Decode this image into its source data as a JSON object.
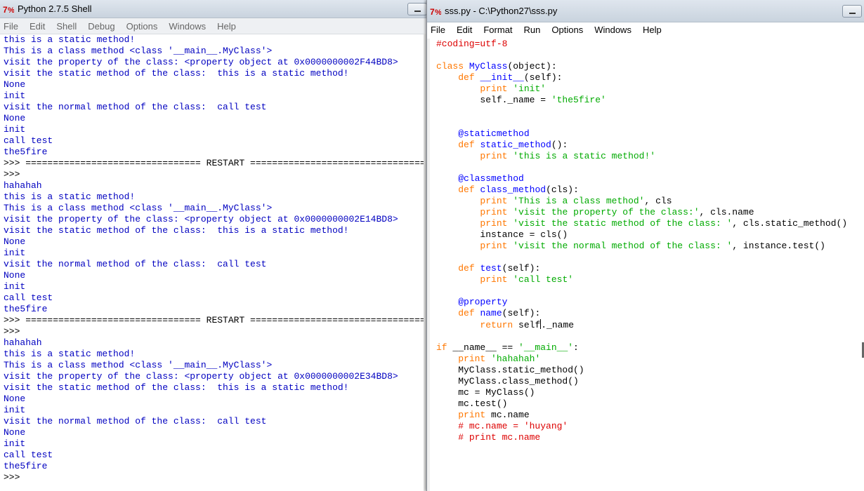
{
  "shell": {
    "title": "Python 2.7.5 Shell",
    "menu": [
      "File",
      "Edit",
      "Shell",
      "Debug",
      "Options",
      "Windows",
      "Help"
    ],
    "lines": [
      {
        "t": "this is a static method!",
        "c": "out"
      },
      {
        "t": "This is a class method <class '__main__.MyClass'>",
        "c": "out"
      },
      {
        "t": "visit the property of the class: <property object at 0x0000000002F44BD8>",
        "c": "out"
      },
      {
        "t": "visit the static method of the class:  this is a static method!",
        "c": "out"
      },
      {
        "t": "None",
        "c": "out"
      },
      {
        "t": "init",
        "c": "out"
      },
      {
        "t": "visit the normal method of the class:  call test",
        "c": "out"
      },
      {
        "t": "None",
        "c": "out"
      },
      {
        "t": "init",
        "c": "out"
      },
      {
        "t": "call test",
        "c": "out"
      },
      {
        "t": "the5fire",
        "c": "out"
      },
      {
        "t": ">>> ================================ RESTART ================================",
        "c": "sys"
      },
      {
        "t": ">>>",
        "c": "sys"
      },
      {
        "t": "hahahah",
        "c": "out"
      },
      {
        "t": "this is a static method!",
        "c": "out"
      },
      {
        "t": "This is a class method <class '__main__.MyClass'>",
        "c": "out"
      },
      {
        "t": "visit the property of the class: <property object at 0x0000000002E14BD8>",
        "c": "out"
      },
      {
        "t": "visit the static method of the class:  this is a static method!",
        "c": "out"
      },
      {
        "t": "None",
        "c": "out"
      },
      {
        "t": "init",
        "c": "out"
      },
      {
        "t": "visit the normal method of the class:  call test",
        "c": "out"
      },
      {
        "t": "None",
        "c": "out"
      },
      {
        "t": "init",
        "c": "out"
      },
      {
        "t": "call test",
        "c": "out"
      },
      {
        "t": "the5fire",
        "c": "out"
      },
      {
        "t": ">>> ================================ RESTART ================================",
        "c": "sys"
      },
      {
        "t": ">>>",
        "c": "sys"
      },
      {
        "t": "hahahah",
        "c": "out"
      },
      {
        "t": "this is a static method!",
        "c": "out"
      },
      {
        "t": "This is a class method <class '__main__.MyClass'>",
        "c": "out"
      },
      {
        "t": "visit the property of the class: <property object at 0x0000000002E34BD8>",
        "c": "out"
      },
      {
        "t": "visit the static method of the class:  this is a static method!",
        "c": "out"
      },
      {
        "t": "None",
        "c": "out"
      },
      {
        "t": "init",
        "c": "out"
      },
      {
        "t": "visit the normal method of the class:  call test",
        "c": "out"
      },
      {
        "t": "None",
        "c": "out"
      },
      {
        "t": "init",
        "c": "out"
      },
      {
        "t": "call test",
        "c": "out"
      },
      {
        "t": "the5fire",
        "c": "out"
      },
      {
        "t": ">>>",
        "c": "sys"
      }
    ]
  },
  "editor": {
    "title": "sss.py - C:\\Python27\\sss.py",
    "menu": [
      "File",
      "Edit",
      "Format",
      "Run",
      "Options",
      "Windows",
      "Help"
    ],
    "code": [
      [
        [
          "#coding=utf-8",
          "cm"
        ]
      ],
      [],
      [
        [
          "class",
          "kw"
        ],
        [
          " ",
          ""
        ],
        [
          "MyClass",
          "fn"
        ],
        [
          "(object):",
          ""
        ]
      ],
      [
        [
          "    ",
          ""
        ],
        [
          "def",
          "kw"
        ],
        [
          " ",
          ""
        ],
        [
          "__init__",
          "fn"
        ],
        [
          "(self):",
          ""
        ]
      ],
      [
        [
          "        ",
          ""
        ],
        [
          "print",
          "kw"
        ],
        [
          " ",
          ""
        ],
        [
          "'init'",
          "str"
        ]
      ],
      [
        [
          "        self._name = ",
          ""
        ],
        [
          "'the5fire'",
          "str"
        ]
      ],
      [],
      [],
      [
        [
          "    ",
          ""
        ],
        [
          "@staticmethod",
          "fn"
        ]
      ],
      [
        [
          "    ",
          ""
        ],
        [
          "def",
          "kw"
        ],
        [
          " ",
          ""
        ],
        [
          "static_method",
          "fn"
        ],
        [
          "():",
          ""
        ]
      ],
      [
        [
          "        ",
          ""
        ],
        [
          "print",
          "kw"
        ],
        [
          " ",
          ""
        ],
        [
          "'this is a static method!'",
          "str"
        ]
      ],
      [],
      [
        [
          "    ",
          ""
        ],
        [
          "@classmethod",
          "fn"
        ]
      ],
      [
        [
          "    ",
          ""
        ],
        [
          "def",
          "kw"
        ],
        [
          " ",
          ""
        ],
        [
          "class_method",
          "fn"
        ],
        [
          "(cls):",
          ""
        ]
      ],
      [
        [
          "        ",
          ""
        ],
        [
          "print",
          "kw"
        ],
        [
          " ",
          ""
        ],
        [
          "'This is a class method'",
          "str"
        ],
        [
          ", cls",
          ""
        ]
      ],
      [
        [
          "        ",
          ""
        ],
        [
          "print",
          "kw"
        ],
        [
          " ",
          ""
        ],
        [
          "'visit the property of the class:'",
          "str"
        ],
        [
          ", cls.name",
          ""
        ]
      ],
      [
        [
          "        ",
          ""
        ],
        [
          "print",
          "kw"
        ],
        [
          " ",
          ""
        ],
        [
          "'visit the static method of the class: '",
          "str"
        ],
        [
          ", cls.static_method()",
          ""
        ]
      ],
      [
        [
          "        instance = cls()",
          ""
        ]
      ],
      [
        [
          "        ",
          ""
        ],
        [
          "print",
          "kw"
        ],
        [
          " ",
          ""
        ],
        [
          "'visit the normal method of the class: '",
          "str"
        ],
        [
          ", instance.test()",
          ""
        ]
      ],
      [],
      [
        [
          "    ",
          ""
        ],
        [
          "def",
          "kw"
        ],
        [
          " ",
          ""
        ],
        [
          "test",
          "fn"
        ],
        [
          "(self):",
          ""
        ]
      ],
      [
        [
          "        ",
          ""
        ],
        [
          "print",
          "kw"
        ],
        [
          " ",
          ""
        ],
        [
          "'call test'",
          "str"
        ]
      ],
      [],
      [
        [
          "    ",
          ""
        ],
        [
          "@property",
          "fn"
        ]
      ],
      [
        [
          "    ",
          ""
        ],
        [
          "def",
          "kw"
        ],
        [
          " ",
          ""
        ],
        [
          "name",
          "fn"
        ],
        [
          "(self):",
          ""
        ]
      ],
      [
        [
          "        ",
          ""
        ],
        [
          "return",
          "kw"
        ],
        [
          " self",
          ""
        ],
        [
          "|",
          "cursor"
        ],
        [
          "._name",
          ""
        ]
      ],
      [],
      [
        [
          "if",
          "kw"
        ],
        [
          " __name__ == ",
          ""
        ],
        [
          "'__main__'",
          "str"
        ],
        [
          ":",
          ""
        ]
      ],
      [
        [
          "    ",
          ""
        ],
        [
          "print",
          "kw"
        ],
        [
          " ",
          ""
        ],
        [
          "'hahahah'",
          "str"
        ]
      ],
      [
        [
          "    MyClass.static_method()",
          ""
        ]
      ],
      [
        [
          "    MyClass.class_method()",
          ""
        ]
      ],
      [
        [
          "    mc = MyClass()",
          ""
        ]
      ],
      [
        [
          "    mc.test()",
          ""
        ]
      ],
      [
        [
          "    ",
          ""
        ],
        [
          "print",
          "kw"
        ],
        [
          " mc.name",
          ""
        ]
      ],
      [
        [
          "    ",
          ""
        ],
        [
          "# mc.name = 'huyang'",
          "cm"
        ]
      ],
      [
        [
          "    ",
          ""
        ],
        [
          "# print mc.name",
          "cm"
        ]
      ]
    ]
  },
  "colors": {
    "shell_output": "#0000c0",
    "keyword": "#ff7700",
    "string": "#00aa00",
    "comment": "#dd0000",
    "definition": "#0000ff"
  },
  "icons": {
    "app": "python-idle-icon",
    "minimize": "minimize-icon"
  }
}
